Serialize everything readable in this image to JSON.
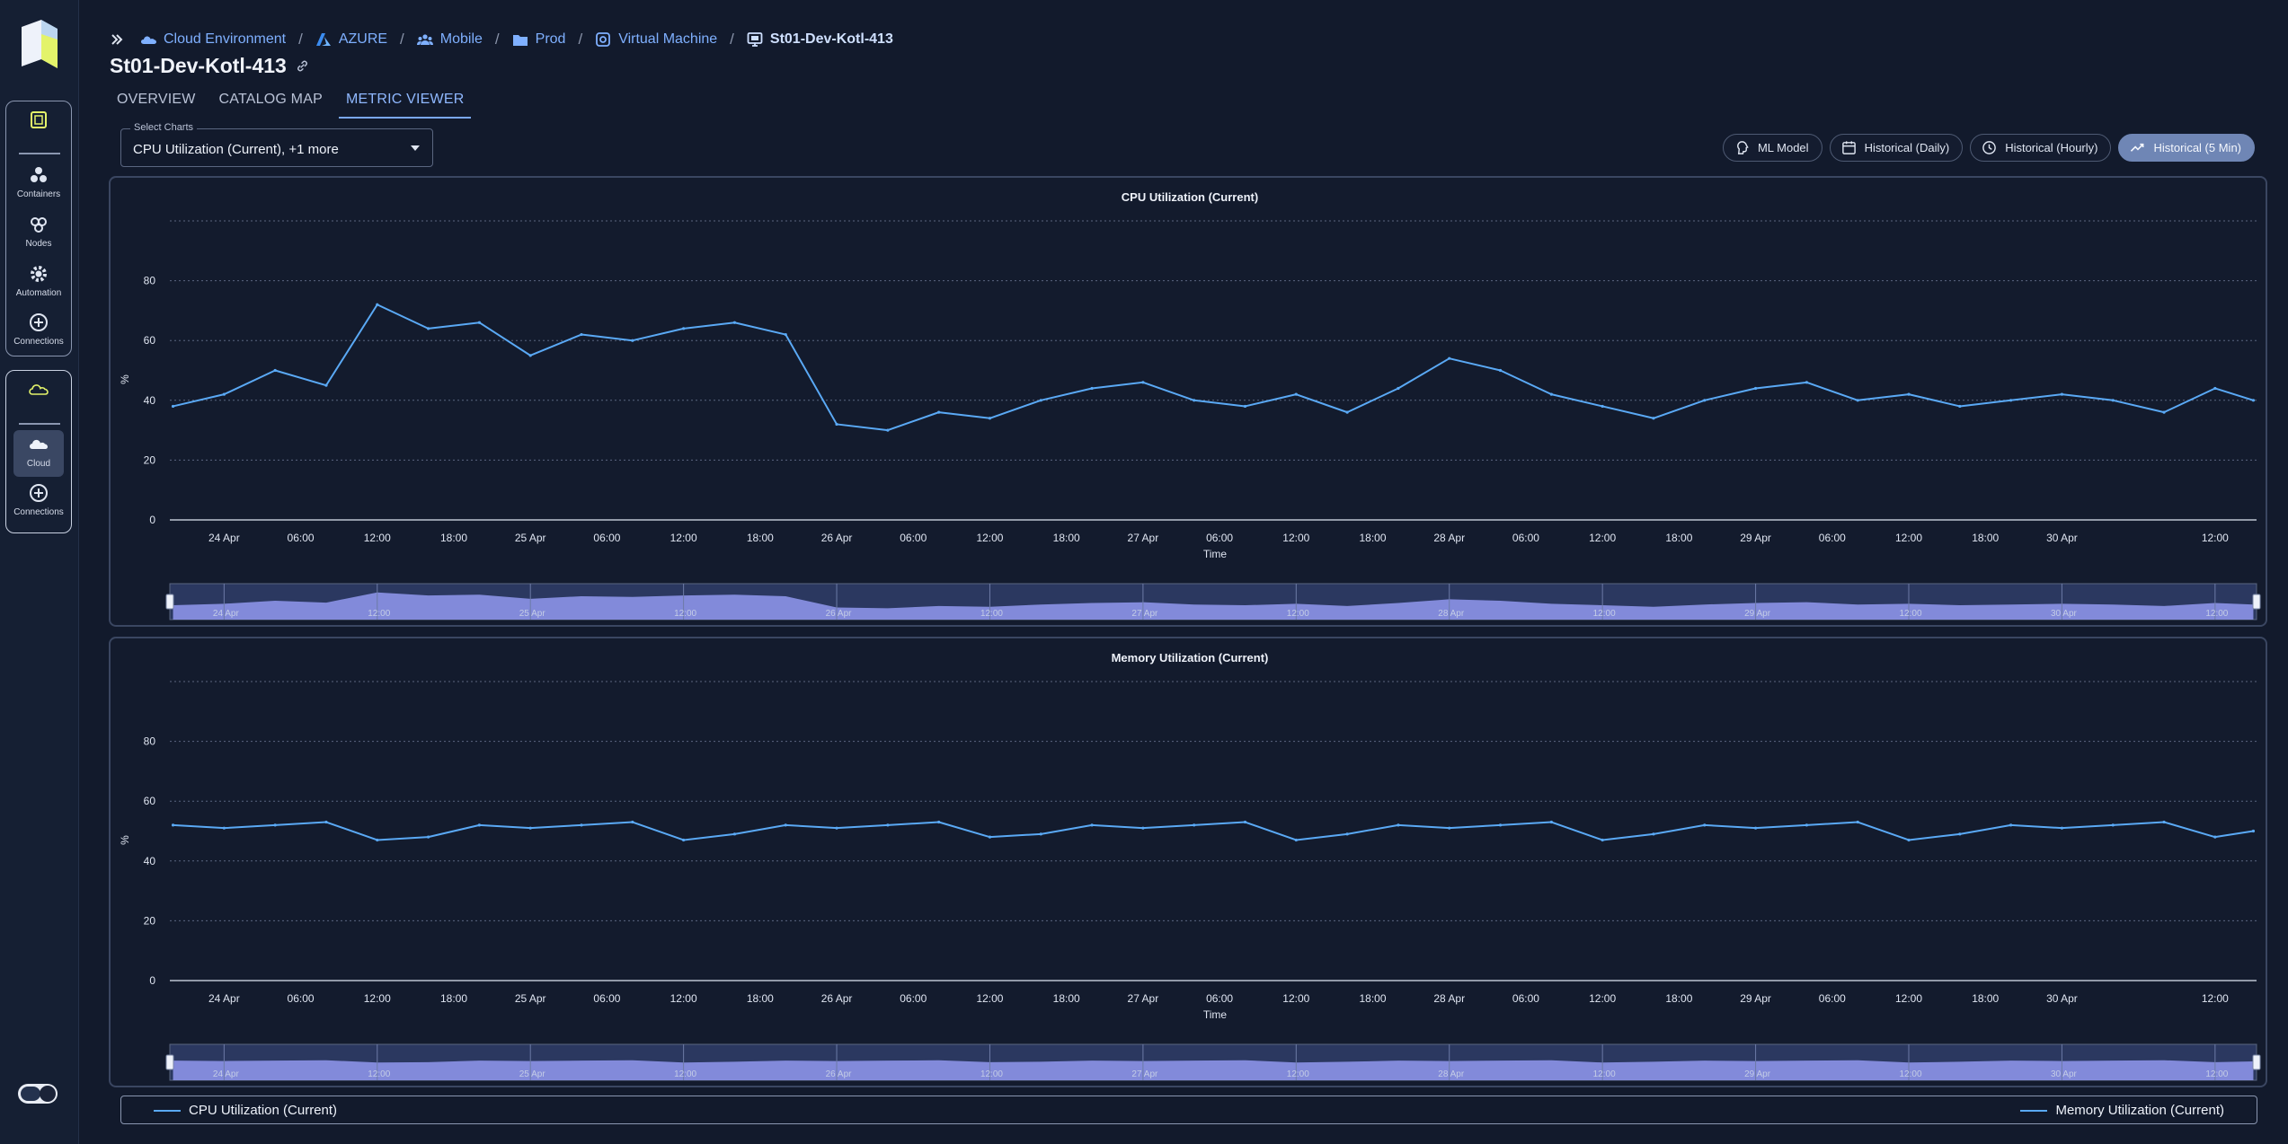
{
  "sidebar": {
    "items": [
      {
        "label": "Containers",
        "icon": "containers-icon"
      },
      {
        "label": "Nodes",
        "icon": "nodes-icon"
      },
      {
        "label": "Automation",
        "icon": "gear-icon"
      },
      {
        "label": "Connections",
        "icon": "plus-circle-icon"
      }
    ],
    "cloud_group": [
      {
        "label": "Cloud",
        "icon": "cloud-icon",
        "active": true
      },
      {
        "label": "Connections",
        "icon": "plus-circle-icon"
      }
    ]
  },
  "breadcrumb": [
    {
      "label": "Cloud Environment",
      "icon": "cloud-env-icon"
    },
    {
      "label": "AZURE",
      "icon": "azure-icon"
    },
    {
      "label": "Mobile",
      "icon": "group-icon"
    },
    {
      "label": "Prod",
      "icon": "folder-icon"
    },
    {
      "label": "Virtual Machine",
      "icon": "instance-icon"
    },
    {
      "label": "St01-Dev-Kotl-413",
      "icon": "monitor-icon"
    }
  ],
  "page_title": "St01-Dev-Kotl-413",
  "tabs": [
    {
      "label": "OVERVIEW"
    },
    {
      "label": "CATALOG MAP"
    },
    {
      "label": "METRIC VIEWER",
      "active": true
    }
  ],
  "select_charts": {
    "label": "Select Charts",
    "value": "CPU Utilization (Current), +1 more"
  },
  "modes": [
    {
      "label": "ML Model",
      "icon": "brain-icon"
    },
    {
      "label": "Historical (Daily)",
      "icon": "calendar-icon"
    },
    {
      "label": "Historical (Hourly)",
      "icon": "clock-icon"
    },
    {
      "label": "Historical (5 Min)",
      "icon": "trend-icon",
      "active": true
    }
  ],
  "colors": {
    "line": "#5aa9f5",
    "navigator_fill": "#8c93e8",
    "background": "#121a2c"
  },
  "chart_data": [
    {
      "type": "line",
      "title": "CPU Utilization (Current)",
      "xlabel": "Time",
      "ylabel": "%",
      "ylim": [
        0,
        100
      ],
      "yticks": [
        "0",
        "20",
        "40",
        "60",
        "80"
      ],
      "xticks": [
        "24 Apr",
        "06:00",
        "12:00",
        "18:00",
        "25 Apr",
        "06:00",
        "12:00",
        "18:00",
        "26 Apr",
        "06:00",
        "12:00",
        "18:00",
        "27 Apr",
        "06:00",
        "12:00",
        "18:00",
        "28 Apr",
        "06:00",
        "12:00",
        "18:00",
        "29 Apr",
        "06:00",
        "12:00",
        "18:00",
        "30 Apr",
        "12:00"
      ],
      "navigator_ticks": [
        "24 Apr",
        "12:00",
        "25 Apr",
        "12:00",
        "26 Apr",
        "12:00",
        "27 Apr",
        "12:00",
        "28 Apr",
        "12:00",
        "29 Apr",
        "12:00",
        "30 Apr",
        "12:00"
      ],
      "grid": true,
      "series": [
        {
          "name": "CPU Utilization (Current)",
          "x": [
            "23 Apr 20:00",
            "24 Apr 00:00",
            "24 Apr 04:00",
            "24 Apr 08:00",
            "24 Apr 12:00",
            "24 Apr 16:00",
            "24 Apr 20:00",
            "25 Apr 00:00",
            "25 Apr 04:00",
            "25 Apr 08:00",
            "25 Apr 12:00",
            "25 Apr 16:00",
            "25 Apr 20:00",
            "26 Apr 00:00",
            "26 Apr 04:00",
            "26 Apr 08:00",
            "26 Apr 12:00",
            "26 Apr 16:00",
            "26 Apr 20:00",
            "27 Apr 00:00",
            "27 Apr 04:00",
            "27 Apr 08:00",
            "27 Apr 12:00",
            "27 Apr 16:00",
            "27 Apr 20:00",
            "28 Apr 00:00",
            "28 Apr 04:00",
            "28 Apr 08:00",
            "28 Apr 12:00",
            "28 Apr 16:00",
            "28 Apr 20:00",
            "29 Apr 00:00",
            "29 Apr 04:00",
            "29 Apr 08:00",
            "29 Apr 12:00",
            "29 Apr 16:00",
            "29 Apr 20:00",
            "30 Apr 00:00",
            "30 Apr 04:00",
            "30 Apr 08:00",
            "30 Apr 12:00",
            "30 Apr 15:00"
          ],
          "values": [
            38,
            42,
            50,
            45,
            72,
            64,
            66,
            55,
            62,
            60,
            64,
            66,
            62,
            32,
            30,
            36,
            34,
            40,
            44,
            46,
            40,
            38,
            42,
            36,
            44,
            54,
            50,
            42,
            38,
            34,
            40,
            44,
            46,
            40,
            42,
            38,
            40,
            42,
            40,
            36,
            44,
            40
          ]
        }
      ]
    },
    {
      "type": "line",
      "title": "Memory Utilization (Current)",
      "xlabel": "Time",
      "ylabel": "%",
      "ylim": [
        0,
        100
      ],
      "yticks": [
        "0",
        "20",
        "40",
        "60",
        "80"
      ],
      "xticks": [
        "24 Apr",
        "06:00",
        "12:00",
        "18:00",
        "25 Apr",
        "06:00",
        "12:00",
        "18:00",
        "26 Apr",
        "06:00",
        "12:00",
        "18:00",
        "27 Apr",
        "06:00",
        "12:00",
        "18:00",
        "28 Apr",
        "06:00",
        "12:00",
        "18:00",
        "29 Apr",
        "06:00",
        "12:00",
        "18:00",
        "30 Apr",
        "12:00"
      ],
      "navigator_ticks": [
        "24 Apr",
        "12:00",
        "25 Apr",
        "12:00",
        "26 Apr",
        "12:00",
        "27 Apr",
        "12:00",
        "28 Apr",
        "12:00",
        "29 Apr",
        "12:00",
        "30 Apr",
        "12:00"
      ],
      "grid": true,
      "series": [
        {
          "name": "Memory Utilization (Current)",
          "x": [
            "23 Apr 20:00",
            "24 Apr 00:00",
            "24 Apr 04:00",
            "24 Apr 08:00",
            "24 Apr 12:00",
            "24 Apr 16:00",
            "24 Apr 20:00",
            "25 Apr 00:00",
            "25 Apr 04:00",
            "25 Apr 08:00",
            "25 Apr 12:00",
            "25 Apr 16:00",
            "25 Apr 20:00",
            "26 Apr 00:00",
            "26 Apr 04:00",
            "26 Apr 08:00",
            "26 Apr 12:00",
            "26 Apr 16:00",
            "26 Apr 20:00",
            "27 Apr 00:00",
            "27 Apr 04:00",
            "27 Apr 08:00",
            "27 Apr 12:00",
            "27 Apr 16:00",
            "27 Apr 20:00",
            "28 Apr 00:00",
            "28 Apr 04:00",
            "28 Apr 08:00",
            "28 Apr 12:00",
            "28 Apr 16:00",
            "28 Apr 20:00",
            "29 Apr 00:00",
            "29 Apr 04:00",
            "29 Apr 08:00",
            "29 Apr 12:00",
            "29 Apr 16:00",
            "29 Apr 20:00",
            "30 Apr 00:00",
            "30 Apr 04:00",
            "30 Apr 08:00",
            "30 Apr 12:00",
            "30 Apr 15:00"
          ],
          "values": [
            52,
            51,
            52,
            53,
            47,
            48,
            52,
            51,
            52,
            53,
            47,
            49,
            52,
            51,
            52,
            53,
            48,
            49,
            52,
            51,
            52,
            53,
            47,
            49,
            52,
            51,
            52,
            53,
            47,
            49,
            52,
            51,
            52,
            53,
            47,
            49,
            52,
            51,
            52,
            53,
            48,
            50
          ]
        }
      ]
    }
  ],
  "legend": [
    {
      "label": "CPU Utilization (Current)"
    },
    {
      "label": "Memory Utilization (Current)"
    }
  ]
}
